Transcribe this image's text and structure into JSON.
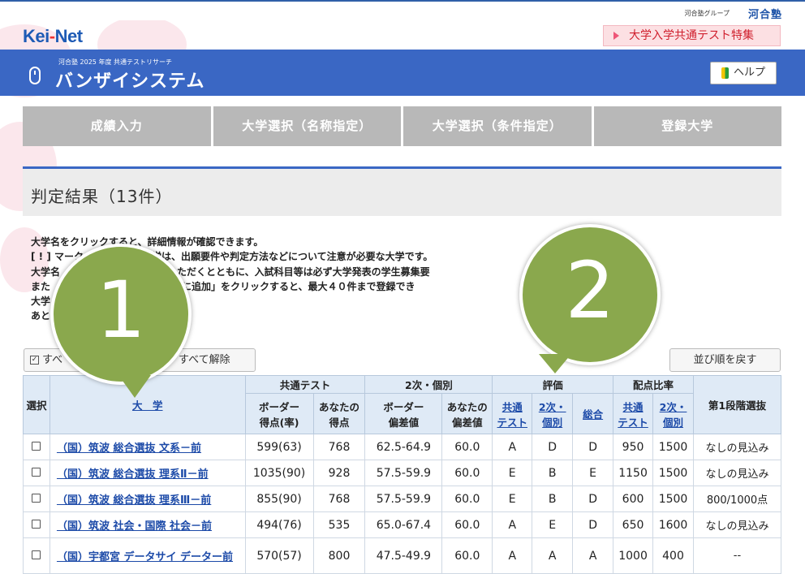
{
  "header": {
    "group_text": "河合塾グループ",
    "group_logo": "河合塾",
    "site_logo_a": "Kei",
    "site_logo_dot": "-",
    "site_logo_b": "Net",
    "feature_link": "大学入学共通テスト特集",
    "system_subtitle": "河合塾 2025 年度 共通テストリサーチ",
    "system_title": "バンザイシステム",
    "help_label": "ヘルプ"
  },
  "tabs": [
    "成績入力",
    "大学選択（名称指定）",
    "大学選択（条件指定）",
    "登録大学"
  ],
  "result": {
    "title": "判定結果（13件）",
    "notes": [
      "大学名をクリックすると、詳細情報が確認できます。",
      "[ ! ] マーク　　　　　る大学は、出願要件や判定方法などについて注意が必要な大学です。",
      "大学名　　　　　　項をご確認いただくとともに、入試科目等は必ず大学発表の学生募集要",
      "また　　　　　　　し、「登録大学に追加」をクリックすると、最大４０件まで登録でき",
      "大学　　　　　　　さい。",
      "あと"
    ]
  },
  "controls": {
    "select_all": "すべ",
    "deselect_all": "すべて解除",
    "reset_sort": "並び順を戻す"
  },
  "table": {
    "headers": {
      "select": "選択",
      "university": "大　学",
      "kyotsu": "共通テスト",
      "niji": "2次・個別",
      "hyoka": "評価",
      "haiten": "配点比率",
      "dai1": "第1段階選抜",
      "border_score_1": "ボーダー",
      "border_score_2": "得点(率)",
      "your_score_1": "あなたの",
      "your_score_2": "得点",
      "border_dev_1": "ボーダー",
      "border_dev_2": "偏差値",
      "your_dev_1": "あなたの",
      "your_dev_2": "偏差値",
      "eval_kyotsu_1": "共通",
      "eval_kyotsu_2": "テスト",
      "eval_niji_1": "2次・",
      "eval_niji_2": "個別",
      "eval_total": "総合",
      "ratio_kyotsu_1": "共通",
      "ratio_kyotsu_2": "テスト",
      "ratio_niji_1": "2次・",
      "ratio_niji_2": "個別"
    },
    "rows": [
      {
        "name": "（国）筑波 総合選抜 文系－前",
        "border": "599(63)",
        "score": "768",
        "bdev": "62.5-64.9",
        "dev": "60.0",
        "e1": "A",
        "e2": "D",
        "e3": "D",
        "r1": "950",
        "r2": "1500",
        "first": "なしの見込み"
      },
      {
        "name": "（国）筑波 総合選抜 理系Ⅱ－前",
        "border": "1035(90)",
        "score": "928",
        "bdev": "57.5-59.9",
        "dev": "60.0",
        "e1": "E",
        "e2": "B",
        "e3": "E",
        "r1": "1150",
        "r2": "1500",
        "first": "なしの見込み"
      },
      {
        "name": "（国）筑波 総合選抜 理系Ⅲ－前",
        "border": "855(90)",
        "score": "768",
        "bdev": "57.5-59.9",
        "dev": "60.0",
        "e1": "E",
        "e2": "B",
        "e3": "D",
        "r1": "600",
        "r2": "1500",
        "first": "800/1000点"
      },
      {
        "name": "（国）筑波 社会・国際 社会－前",
        "border": "494(76)",
        "score": "535",
        "bdev": "65.0-67.4",
        "dev": "60.0",
        "e1": "A",
        "e2": "E",
        "e3": "D",
        "r1": "650",
        "r2": "1600",
        "first": "なしの見込み"
      },
      {
        "name": "（国）宇都宮 データサイ データー前",
        "border": "570(57)",
        "score": "800",
        "bdev": "47.5-49.9",
        "dev": "60.0",
        "e1": "A",
        "e2": "A",
        "e3": "A",
        "r1": "1000",
        "r2": "400",
        "first": "--"
      }
    ]
  },
  "callouts": [
    "1",
    "2"
  ],
  "colors": {
    "brand_blue": "#3a67c4",
    "callout_green": "#8aa84d",
    "link": "#1c4aa8"
  }
}
